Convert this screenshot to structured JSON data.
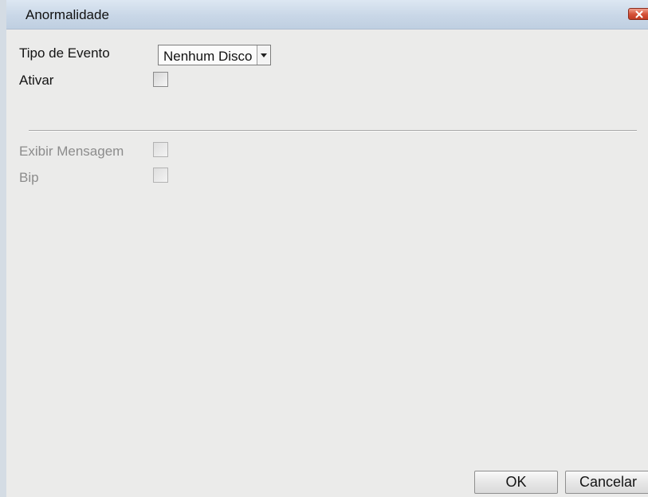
{
  "window": {
    "title": "Anormalidade"
  },
  "form": {
    "event_type": {
      "label": "Tipo de Evento",
      "value": "Nenhum Disco"
    },
    "enable": {
      "label": "Ativar",
      "checked": false
    },
    "show_message": {
      "label": "Exibir Mensagem",
      "checked": false,
      "enabled": false
    },
    "beep": {
      "label": "Bip",
      "checked": false,
      "enabled": false
    }
  },
  "footer": {
    "ok_label": "OK",
    "cancel_label": "Cancelar"
  },
  "icons": {
    "close": "close-icon",
    "dropdown": "chevron-down-icon"
  },
  "colors": {
    "titlebar": "#c9d7e7",
    "close_button": "#d6543b",
    "window_bg": "#ebebea",
    "disabled_text": "#8c8c8c"
  }
}
